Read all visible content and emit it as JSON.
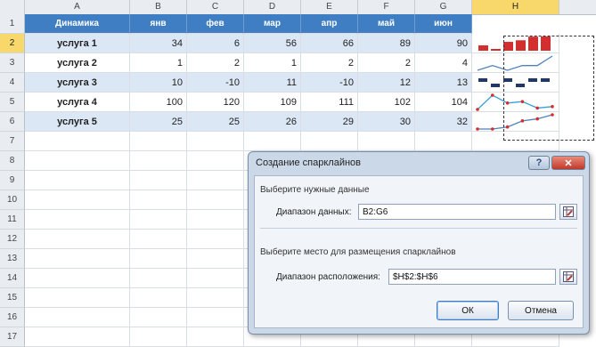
{
  "columns": [
    "A",
    "B",
    "C",
    "D",
    "E",
    "F",
    "G",
    "H"
  ],
  "selected_column": "H",
  "row_numbers": [
    "1",
    "2",
    "3",
    "4",
    "5",
    "6",
    "7",
    "8",
    "9",
    "10",
    "11",
    "12",
    "13",
    "14",
    "15",
    "16",
    "17"
  ],
  "selected_row": "2",
  "table": {
    "headers": [
      "Динамика",
      "янв",
      "фев",
      "мар",
      "апр",
      "май",
      "июн"
    ],
    "rows": [
      {
        "label": "услуга 1",
        "values": [
          "34",
          "6",
          "56",
          "66",
          "89",
          "90"
        ]
      },
      {
        "label": "услуга 2",
        "values": [
          "1",
          "2",
          "1",
          "2",
          "2",
          "4"
        ]
      },
      {
        "label": "услуга 3",
        "values": [
          "10",
          "-10",
          "11",
          "-10",
          "12",
          "13"
        ]
      },
      {
        "label": "услуга 4",
        "values": [
          "100",
          "120",
          "109",
          "111",
          "102",
          "104"
        ]
      },
      {
        "label": "услуга 5",
        "values": [
          "25",
          "25",
          "26",
          "29",
          "30",
          "32"
        ]
      }
    ]
  },
  "sparklines": [
    {
      "type": "column",
      "values": [
        34,
        6,
        56,
        66,
        89,
        90
      ],
      "color": "#d32f2f"
    },
    {
      "type": "line",
      "values": [
        1,
        2,
        1,
        2,
        2,
        4
      ],
      "color": "#4f81bd"
    },
    {
      "type": "winloss",
      "values": [
        10,
        -10,
        11,
        -10,
        12,
        13
      ],
      "color": "#1f3864"
    },
    {
      "type": "line-markers",
      "values": [
        100,
        120,
        109,
        111,
        102,
        104
      ],
      "color": "#39a0d8",
      "marker_color": "#d32f2f"
    },
    {
      "type": "line-markers",
      "values": [
        25,
        25,
        26,
        29,
        30,
        32
      ],
      "color": "#4f81bd",
      "marker_color": "#d32f2f"
    }
  ],
  "dialog": {
    "title": "Создание спарклайнов",
    "help_icon": "question-icon",
    "close_icon": "close-icon",
    "section_data": "Выберите нужные данные",
    "data_range_label": "Диапазон данных:",
    "data_range_value": "B2:G6",
    "section_location": "Выберите место для размещения спарклайнов",
    "location_range_label": "Диапазон расположения:",
    "location_range_value": "$H$2:$H$6",
    "range_picker_icon": "range-picker-icon",
    "ok_label": "ОК",
    "cancel_label": "Отмена"
  },
  "colors": {
    "header_fill": "#3f7ec3",
    "band_fill": "#dbe7f5",
    "selection_highlight": "#f8d86b"
  }
}
